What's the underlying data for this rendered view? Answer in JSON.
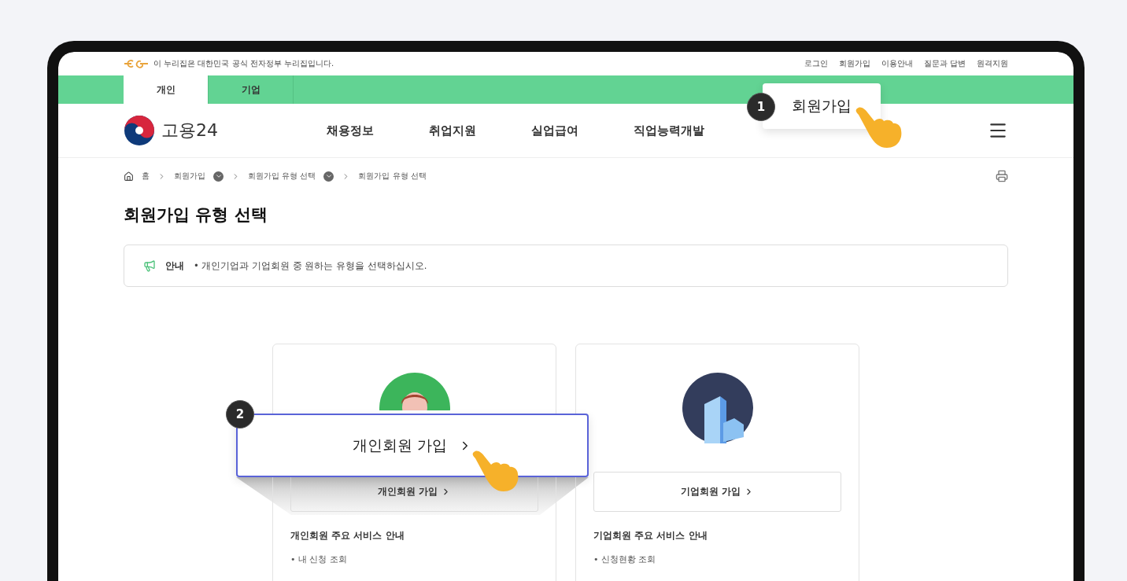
{
  "gov_notice": "이 누리집은 대한민국 공식 전자정부 누리집입니다.",
  "utility_links": [
    "로그인",
    "회원가입",
    "이용안내",
    "질문과 답변",
    "원격지원"
  ],
  "audience_tabs": [
    {
      "label": "개인",
      "selected": true
    },
    {
      "label": "기업",
      "selected": false
    }
  ],
  "logo": {
    "text": "고용24"
  },
  "nav": [
    "채용정보",
    "취업지원",
    "실업급여",
    "직업능력개발"
  ],
  "breadcrumb": [
    {
      "label": "홈",
      "kind": "home"
    },
    {
      "label": "회원가입",
      "kind": "dropdown"
    },
    {
      "label": "회원가입 유형 선택",
      "kind": "dropdown"
    },
    {
      "label": "회원가입 유형 선택",
      "kind": "plain"
    }
  ],
  "page_title": "회원가입 유형 선택",
  "notice": {
    "label": "안내",
    "text": "• 개인기업과 기업회원 중 원하는 유형을 선택하십시오."
  },
  "cards": [
    {
      "kind": "person",
      "button": "개인회원 가입",
      "services_title": "개인회원 주요 서비스 안내",
      "services": [
        "• 내 신청 조회"
      ]
    },
    {
      "kind": "company",
      "button": "기업회원 가입",
      "services_title": "기업회원 주요 서비스 안내",
      "services": [
        "• 신청현황 조회"
      ]
    }
  ],
  "callouts": [
    {
      "number": "1",
      "label": "회원가입"
    },
    {
      "number": "2",
      "label": "개인회원 가입"
    }
  ]
}
